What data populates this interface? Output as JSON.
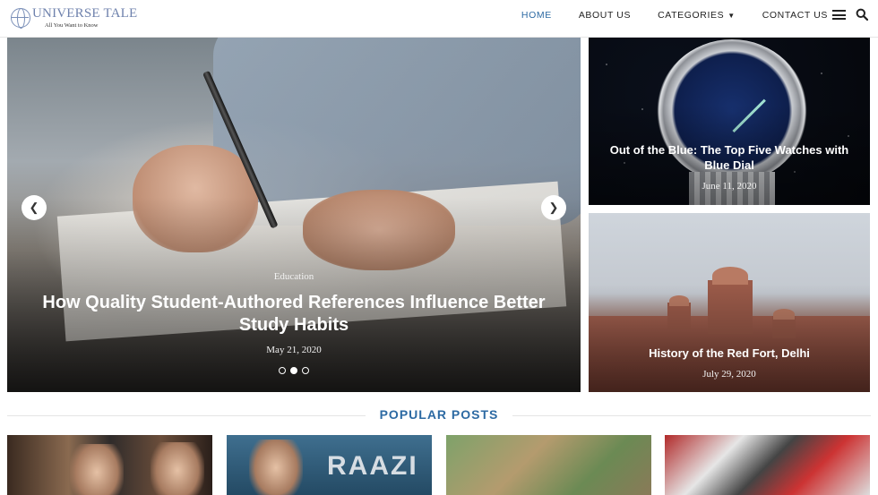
{
  "header": {
    "logo_title": "UNIVERSE TALE",
    "logo_tagline": "All You Want to Know",
    "nav": [
      {
        "label": "HOME",
        "active": true
      },
      {
        "label": "ABOUT US",
        "active": false
      },
      {
        "label": "CATEGORIES",
        "active": false,
        "has_dropdown": true
      },
      {
        "label": "CONTACT US",
        "active": false
      }
    ],
    "menu_icon": "hamburger-icon",
    "search_icon": "search-icon",
    "accent_color": "#2d6aa3"
  },
  "slider": {
    "category": "Education",
    "title": "How Quality Student-Authored References Influence Better Study Habits",
    "date": "May 21, 2020",
    "prev_icon": "chevron-left-icon",
    "next_icon": "chevron-right-icon",
    "dots": [
      {
        "active": false
      },
      {
        "active": true
      },
      {
        "active": false
      }
    ]
  },
  "featured": [
    {
      "title": "Out of the Blue: The Top Five Watches with Blue Dial",
      "date": "June 11, 2020"
    },
    {
      "title": "History of the Red Fort, Delhi",
      "date": "July 29, 2020"
    }
  ],
  "popular": {
    "heading": "POPULAR POSTS",
    "thumbs": [
      {
        "caption": ""
      },
      {
        "caption": "RAAZI"
      },
      {
        "caption": ""
      },
      {
        "caption": ""
      }
    ]
  }
}
